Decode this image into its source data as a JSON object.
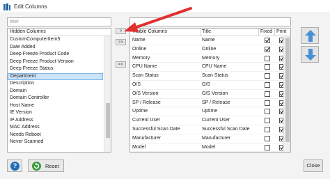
{
  "window": {
    "title": "Edit Columns"
  },
  "filter": {
    "placeholder": "filter"
  },
  "hidden_list": {
    "header": "Hidden Columns",
    "items": [
      "CustomComputerItem5",
      "Date Added",
      "Deep Freeze Product Code",
      "Deep Freeze Product Version",
      "Deep Freeze Status",
      "Department",
      "Description",
      "Domain",
      "Domain Controller",
      "Host Name",
      "IE Version",
      "IP Address",
      "MAC Address",
      "Needs Reboot",
      "Never Scanned"
    ],
    "selected": "Department"
  },
  "transfer_buttons": {
    "move_one_right": ">",
    "move_all_right": ">>",
    "move_all_left": "<<"
  },
  "visible_grid": {
    "columns": [
      "Visible Columns",
      "Title",
      "Fixed",
      "Print"
    ],
    "rows": [
      {
        "name": "Name",
        "title": "Name",
        "fixed": true,
        "print": true
      },
      {
        "name": "Online",
        "title": "Online",
        "fixed": true,
        "print": true
      },
      {
        "name": "Memory",
        "title": "Memory",
        "fixed": false,
        "print": true
      },
      {
        "name": "CPU Name",
        "title": "CPU Name",
        "fixed": false,
        "print": true
      },
      {
        "name": "Scan Status",
        "title": "Scan Status",
        "fixed": false,
        "print": true
      },
      {
        "name": "O/S",
        "title": "O/S",
        "fixed": false,
        "print": true
      },
      {
        "name": "O/S Version",
        "title": "O/S Version",
        "fixed": false,
        "print": true
      },
      {
        "name": "SP / Release",
        "title": "SP / Release",
        "fixed": false,
        "print": true
      },
      {
        "name": "Uptime",
        "title": "Uptime",
        "fixed": false,
        "print": true
      },
      {
        "name": "Current User",
        "title": "Current User",
        "fixed": false,
        "print": true
      },
      {
        "name": "Successful Scan Date",
        "title": "Successful Scan Date",
        "fixed": false,
        "print": true
      },
      {
        "name": "Manufacturer",
        "title": "Manufacturer",
        "fixed": false,
        "print": true
      },
      {
        "name": "Model",
        "title": "Model",
        "fixed": false,
        "print": true
      }
    ]
  },
  "footer": {
    "help_label": "?",
    "reset_label": "Reset",
    "close_label": "Close"
  },
  "colors": {
    "accent_blue": "#1f6fb5",
    "selection": "#cce4f7",
    "annotation_red": "#e03030",
    "arrow_blue": "#4a8fd6"
  },
  "icons": {
    "app": "columns-icon",
    "move_up": "arrow-up-icon",
    "move_down": "arrow-down-icon",
    "reset": "reset-icon",
    "help": "help-icon"
  }
}
